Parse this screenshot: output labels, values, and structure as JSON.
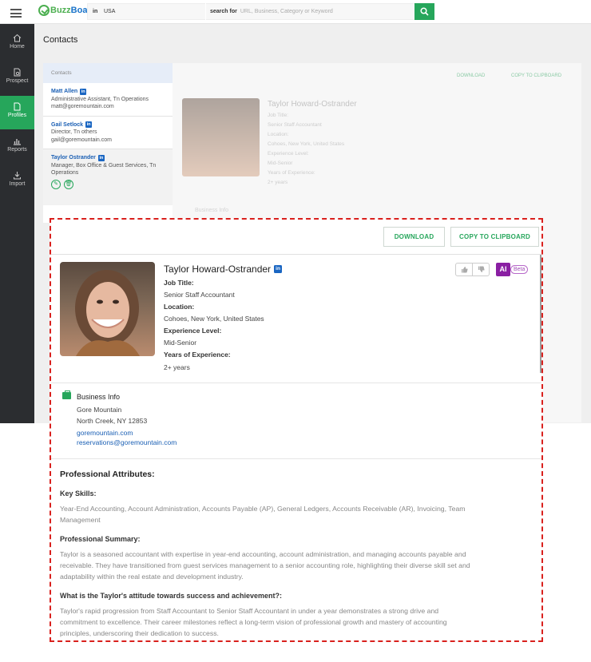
{
  "header": {
    "logo_left": "Buzz",
    "logo_right": "Board",
    "in_label": "in",
    "location_value": "USA",
    "search_for_label": "search for",
    "search_placeholder": "URL, Business, Category or Keyword"
  },
  "sidebar": {
    "items": [
      {
        "label": "Home",
        "icon": "home-icon"
      },
      {
        "label": "Prospect",
        "icon": "prospect-icon"
      },
      {
        "label": "Profiles",
        "icon": "profiles-icon",
        "active": true
      },
      {
        "label": "Reports",
        "icon": "reports-icon"
      },
      {
        "label": "Import",
        "icon": "import-icon"
      }
    ]
  },
  "page": {
    "title": "Contacts",
    "contacts_header": "Contacts",
    "contacts": [
      {
        "name": "Matt Allen",
        "title": "Administrative Assistant, Tn Operations",
        "email": "matt@goremountain.com"
      },
      {
        "name": "Gail Setlock",
        "title": "Director, Tn others",
        "email": "gail@goremountain.com"
      },
      {
        "name": "Taylor Ostrander",
        "title": "Manager, Box Office & Guest Services, Tn Operations",
        "email": ""
      }
    ]
  },
  "card": {
    "download_label": "DOWNLOAD",
    "copy_label": "COPY TO CLIPBOARD",
    "name": "Taylor Howard-Ostrander",
    "linkedin": "in",
    "ai_label": "AI",
    "beta_label": "Beta",
    "job_title_label": "Job Title:",
    "job_title": "Senior Staff Accountant",
    "location_label": "Location:",
    "location": "Cohoes, New York, United States",
    "experience_label": "Experience Level:",
    "experience": "Mid-Senior",
    "years_label": "Years of Experience:",
    "years": "2+ years",
    "business_info_label": "Business Info",
    "business_name": "Gore Mountain",
    "business_address": "North Creek, NY 12853",
    "business_website": "goremountain.com",
    "business_email": "reservations@goremountain.com",
    "pro_attributes_title": "Professional Attributes:",
    "key_skills_label": "Key Skills:",
    "key_skills_line1": "Year-End Accounting, Account Administration, Accounts Payable (AP), General Ledgers, Accounts Receivable (AR), Invoicing, Team",
    "key_skills_line2": "Management",
    "summary_label": "Professional Summary:",
    "summary_line1": "Taylor is a seasoned accountant with expertise in year-end accounting, account administration, and managing accounts payable and",
    "summary_line2": "receivable. They have transitioned from guest services management to a senior accounting role, highlighting their diverse skill set and",
    "summary_line3": "adaptability within the real estate and development industry.",
    "attitude_label": "What is the Taylor's attitude towards success and achievement?:",
    "attitude_line1": "Taylor's rapid progression from Staff Accountant to Senior Staff Accountant in under a year demonstrates a strong drive and",
    "attitude_line2": "commitment to excellence. Their career milestones reflect a long-term vision of professional growth and mastery of accounting",
    "attitude_line3": "principles, underscoring their dedication to success."
  },
  "colors": {
    "accent": "#26a65b",
    "sidebar": "#2b2d30",
    "link": "#1a5fb4",
    "ai": "#8a1fa3",
    "highlight": "#d9201d"
  }
}
